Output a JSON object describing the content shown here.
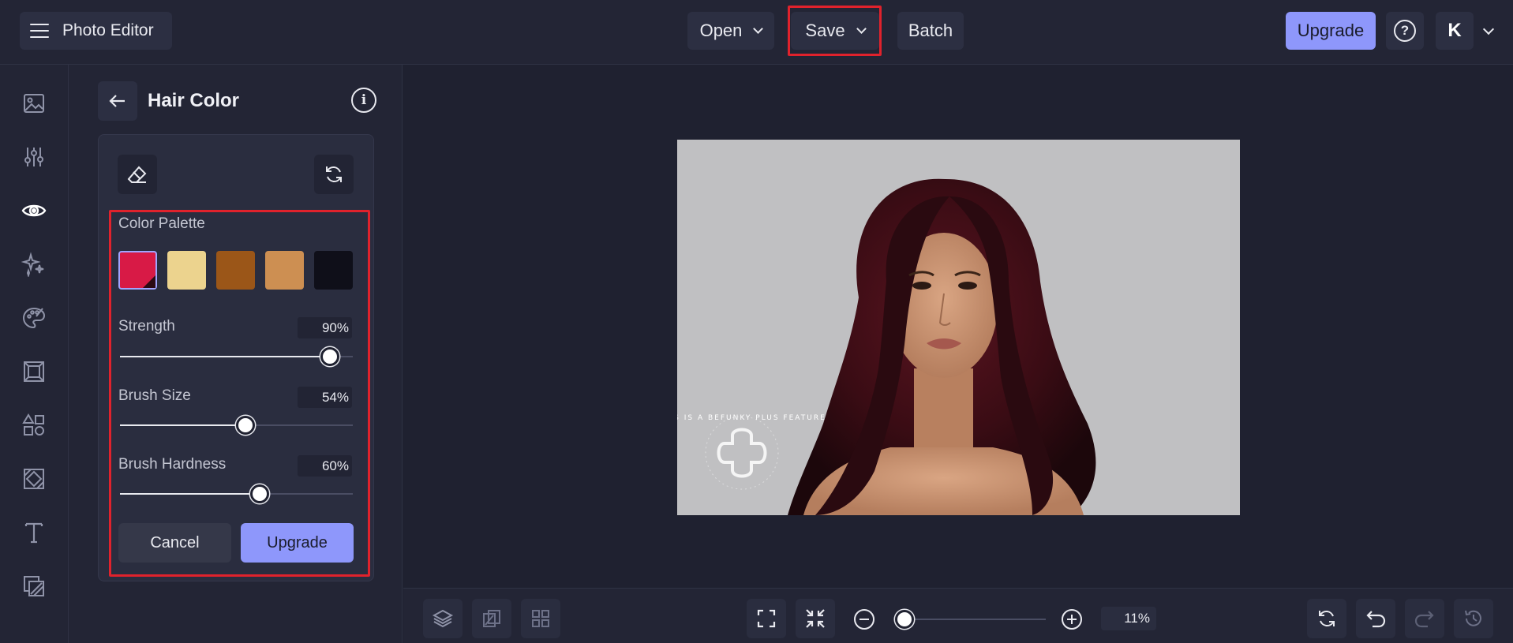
{
  "app": {
    "title": "Photo Editor"
  },
  "toolbar": {
    "open_label": "Open",
    "save_label": "Save",
    "batch_label": "Batch",
    "upgrade_label": "Upgrade",
    "avatar_initial": "K"
  },
  "rail": {
    "items": [
      "image-icon",
      "sliders-icon",
      "eye-icon",
      "sparkle-icon",
      "palette-icon",
      "frame-icon",
      "shapes-icon",
      "texture-icon",
      "text-icon",
      "collage-icon"
    ],
    "active": "eye-icon"
  },
  "panel": {
    "title": "Hair Color",
    "color_palette_label": "Color Palette",
    "swatches": [
      "#d81a46",
      "#ecd38e",
      "#9b5618",
      "#cd8f52",
      "#0f0f19"
    ],
    "selected_swatch": 0,
    "strength": {
      "label": "Strength",
      "value": "90",
      "unit": "%",
      "fraction": 0.9
    },
    "brush_size": {
      "label": "Brush Size",
      "value": "54",
      "unit": "%",
      "fraction": 0.54
    },
    "brush_hardness": {
      "label": "Brush Hardness",
      "value": "60",
      "unit": "%",
      "fraction": 0.6
    },
    "cancel_label": "Cancel",
    "upgrade_label": "Upgrade"
  },
  "canvas": {
    "watermark_text": "THIS IS A BEFUNKY PLUS FEATURE"
  },
  "bottom": {
    "zoom_value": "11",
    "zoom_unit": "%",
    "zoom_fraction": 0.02
  },
  "colors": {
    "accent": "#8e97fb",
    "highlight": "#e0222c"
  }
}
